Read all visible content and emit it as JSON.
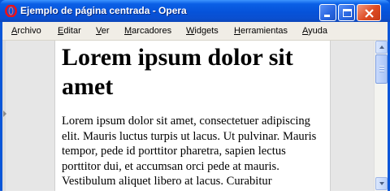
{
  "window": {
    "title": "Ejemplo de página centrada - Opera",
    "app_icon": "opera-icon",
    "controls": [
      "minimize-icon",
      "maximize-icon",
      "close-icon"
    ],
    "colors": {
      "titlebar": "#0653d9",
      "close_button": "#dd4a22",
      "menubar": "#f0ede6",
      "page_background": "#ffffff",
      "surround": "#e6e6e6"
    }
  },
  "menubar": {
    "items": [
      {
        "label": "Archivo"
      },
      {
        "label": "Editar"
      },
      {
        "label": "Ver"
      },
      {
        "label": "Marcadores"
      },
      {
        "label": "Widgets"
      },
      {
        "label": "Herramientas"
      },
      {
        "label": "Ayuda"
      }
    ]
  },
  "page": {
    "heading": "Lorem ipsum dolor sit amet",
    "paragraph": "Lorem ipsum dolor sit amet, consectetuer adipiscing elit. Mauris luctus turpis ut lacus. Ut pulvinar. Mauris tempor, pede id porttitor pharetra, sapien lectus porttitor dui, et accumsan orci pede at mauris. Vestibulum aliquet libero at lacus. Curabitur"
  },
  "scrollbar": {
    "up_icon": "arrow-up-icon",
    "down_icon": "arrow-down-icon"
  }
}
